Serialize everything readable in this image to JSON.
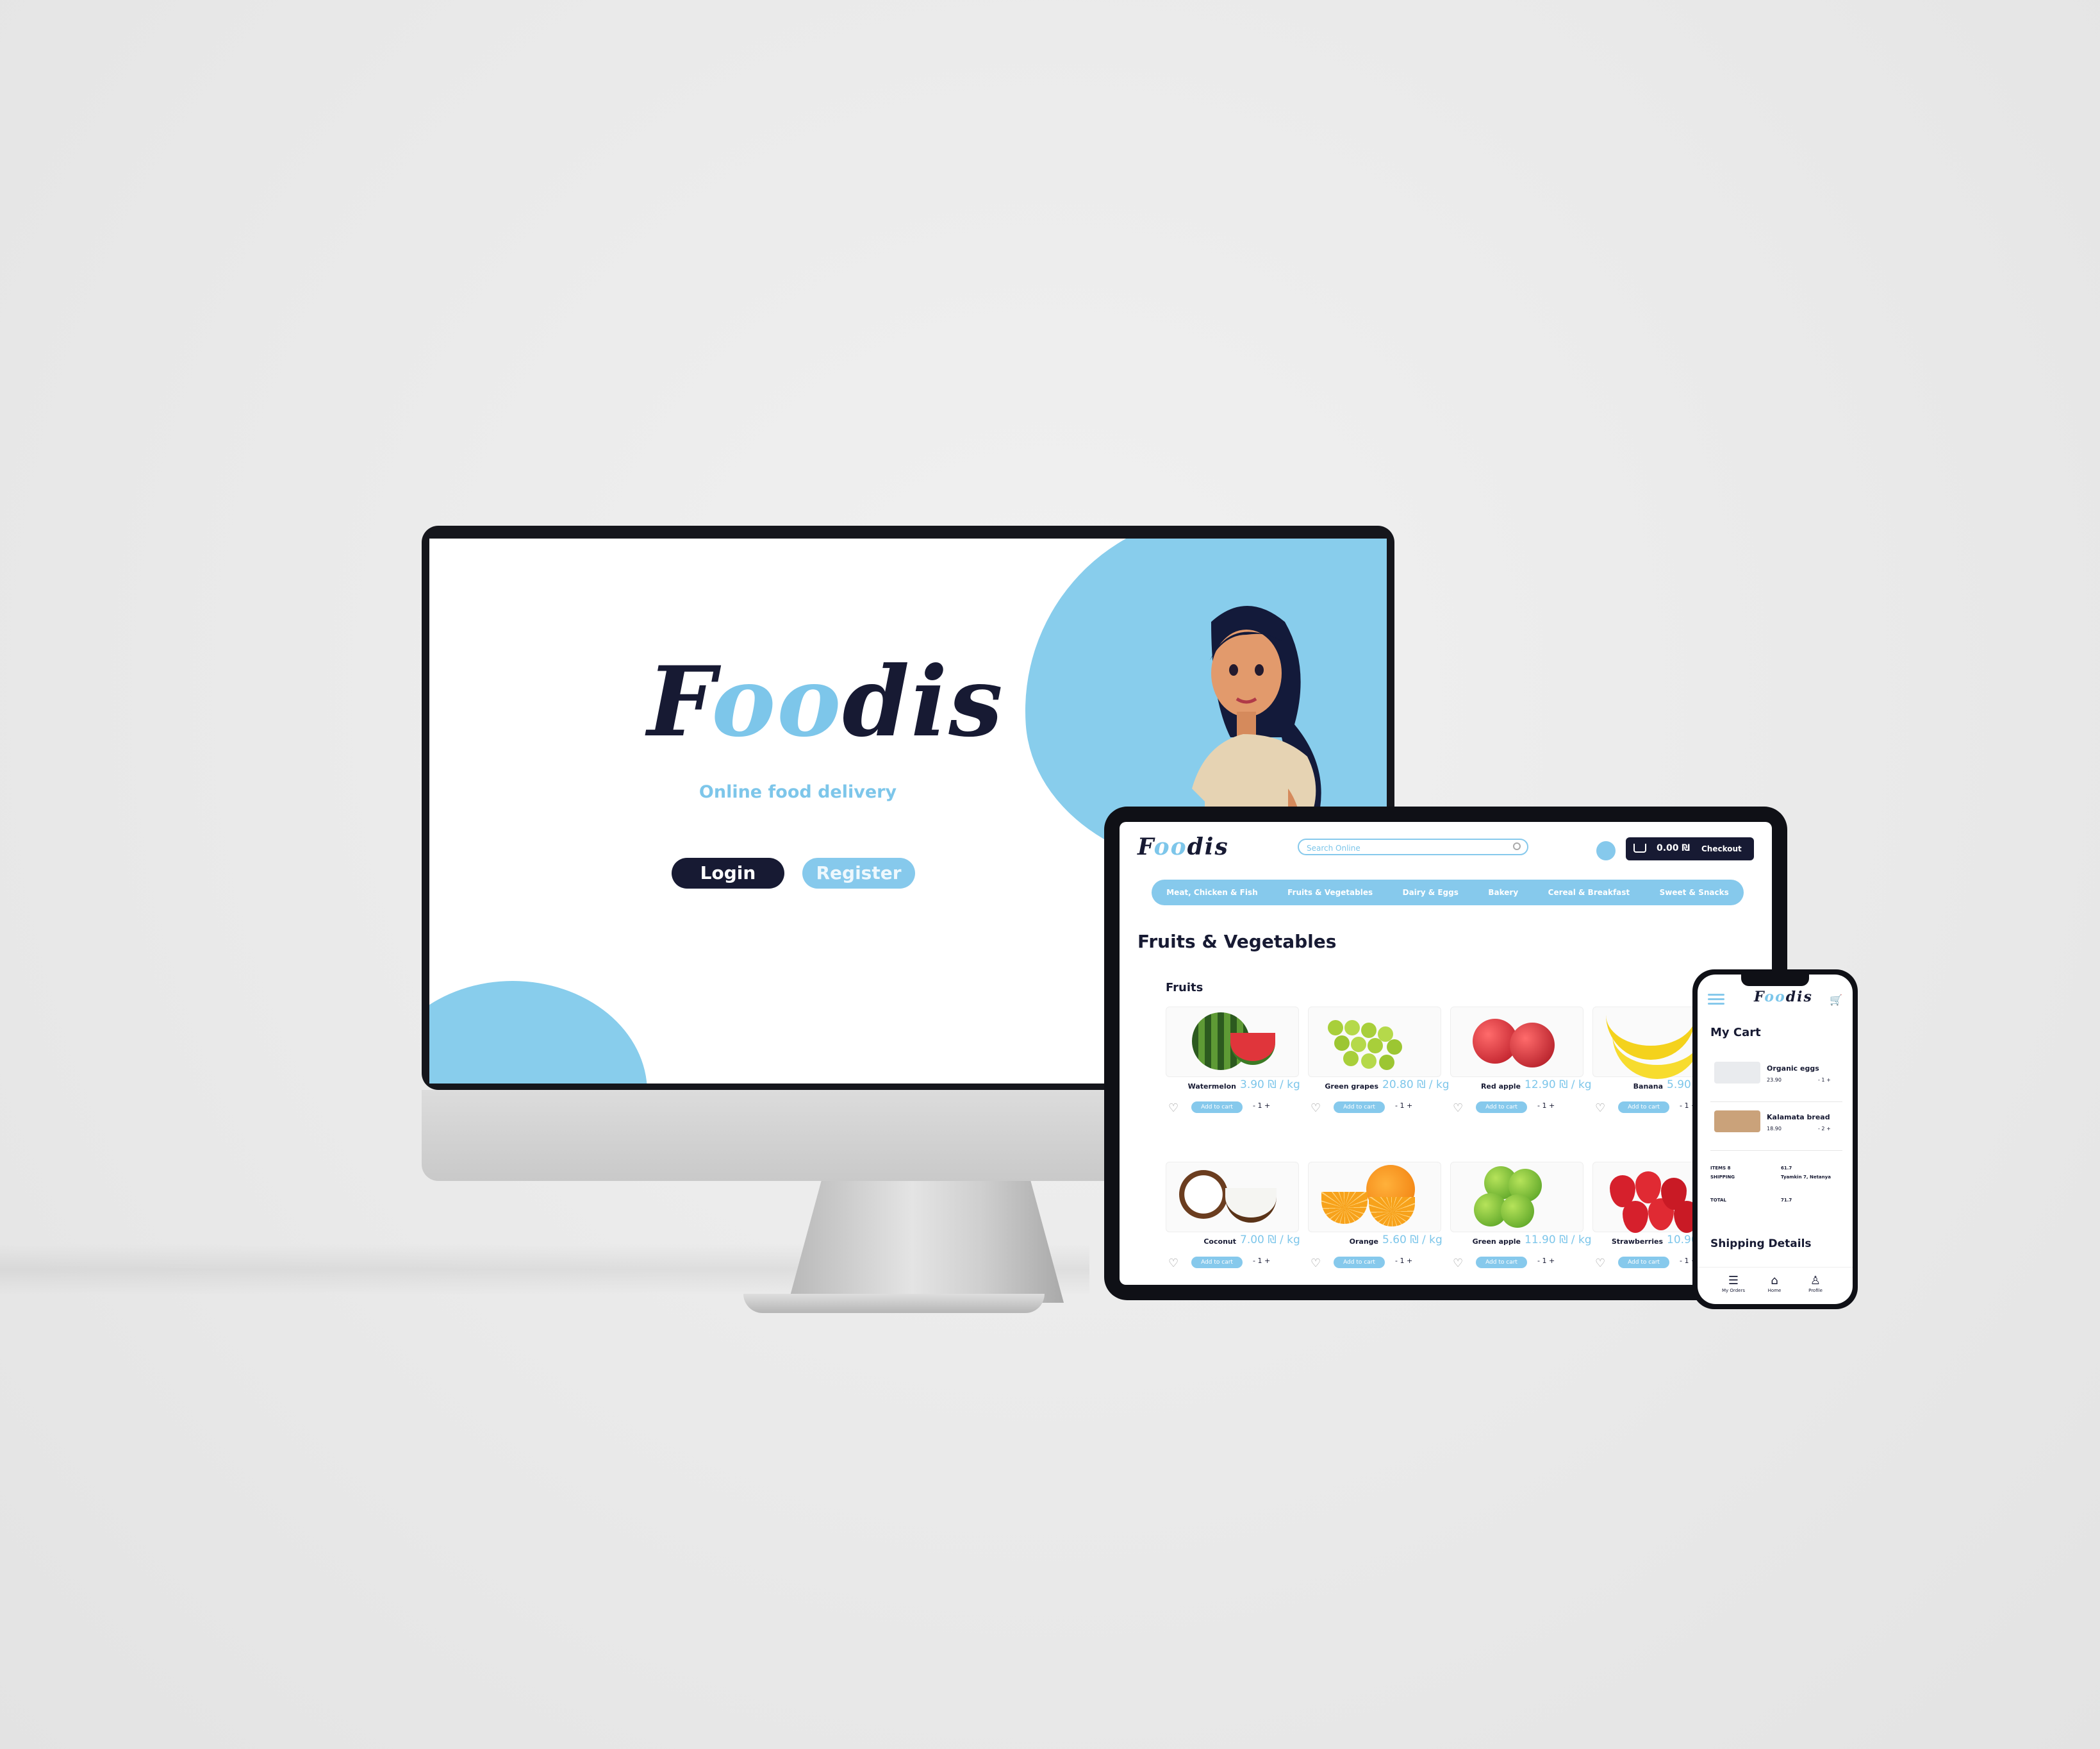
{
  "colors": {
    "navy": "#171a33",
    "sky": "#86c9ec",
    "sky_text": "#7dc6ea",
    "background": "#ececec"
  },
  "desktop": {
    "logo": {
      "part1": "F",
      "part2": "oo",
      "part3": "dis"
    },
    "tagline": "Online food delivery",
    "login_label": "Login",
    "register_label": "Register"
  },
  "tablet": {
    "logo": {
      "part1": "F",
      "part2": "oo",
      "part3": "dis"
    },
    "search_placeholder": "Search Online",
    "cart_amount": "0.00",
    "checkout_label": "Checkout",
    "nav": [
      "Meat, Chicken & Fish",
      "Fruits & Vegetables",
      "Dairy & Eggs",
      "Bakery",
      "Cereal & Breakfast",
      "Sweet & Snacks"
    ],
    "heading": "Fruits & Vegetables",
    "subheading": "Fruits",
    "add_to_cart_label": "Add to cart",
    "qty_label": "- 1 +",
    "products": [
      {
        "name": "Watermelon",
        "price": "3.90 ₪ / kg",
        "icon": "watermelon"
      },
      {
        "name": "Green grapes",
        "price": "20.80 ₪ / kg",
        "icon": "green-grapes"
      },
      {
        "name": "Red apple",
        "price": "12.90 ₪ / kg",
        "icon": "red-apple"
      },
      {
        "name": "Banana",
        "price": "5.90 ₪ / kg",
        "icon": "banana"
      },
      {
        "name": "Coconut",
        "price": "7.00 ₪ / kg",
        "icon": "coconut"
      },
      {
        "name": "Orange",
        "price": "5.60 ₪ / kg",
        "icon": "orange"
      },
      {
        "name": "Green apple",
        "price": "11.90 ₪ / kg",
        "icon": "green-apple"
      },
      {
        "name": "Strawberries",
        "price": "10.90 ₪ / kg",
        "icon": "strawberries"
      }
    ]
  },
  "phone": {
    "logo": {
      "part1": "F",
      "part2": "oo",
      "part3": "dis"
    },
    "title": "My Cart",
    "items": [
      {
        "name": "Organic eggs",
        "price": "23.90",
        "qty": "- 1 +"
      },
      {
        "name": "Kalamata bread",
        "price": "18.90",
        "qty": "- 2 +"
      }
    ],
    "summary": {
      "items_label": "ITEMS",
      "items_count": "8",
      "items_value": "61.7",
      "shipping_label": "SHIPPING",
      "shipping_value": "Tyamkin 7, Netanya",
      "total_label": "TOTAL",
      "total_value": "71.7"
    },
    "shipping_heading": "Shipping Details",
    "tabs": [
      {
        "label": "My Orders",
        "icon": "list-icon"
      },
      {
        "label": "Home",
        "icon": "home-icon"
      },
      {
        "label": "Profile",
        "icon": "person-icon"
      }
    ]
  }
}
